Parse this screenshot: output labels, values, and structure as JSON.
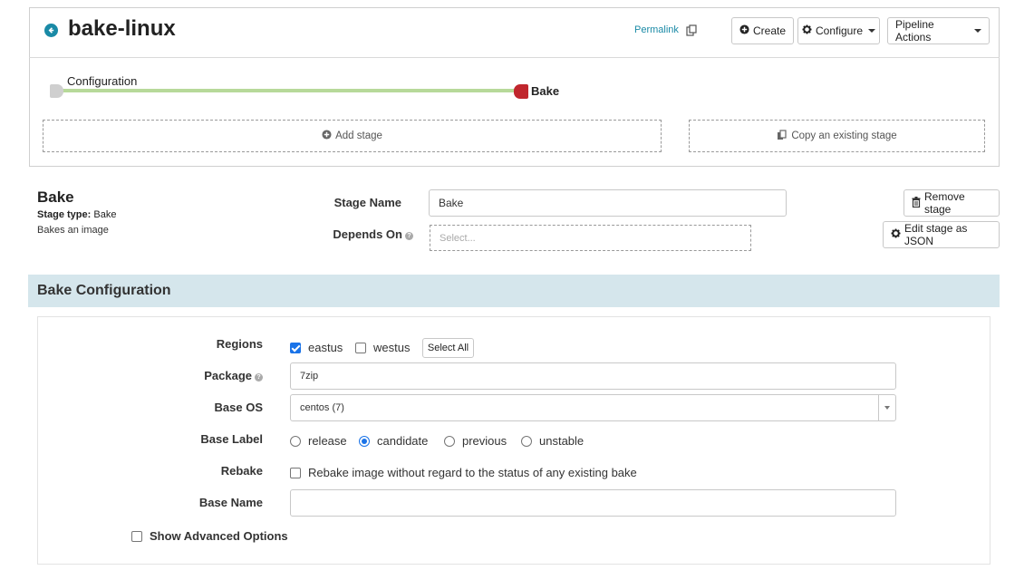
{
  "header": {
    "title": "bake-linux",
    "permalink": "Permalink",
    "create_label": "Create",
    "configure_label": "Configure",
    "pipeline_actions_label": "Pipeline Actions"
  },
  "graph": {
    "nodes": [
      "Configuration",
      "Bake"
    ],
    "add_stage": "Add stage",
    "copy_stage": "Copy an existing stage"
  },
  "stage": {
    "title": "Bake",
    "type_label": "Stage type:",
    "type_value": "Bake",
    "description": "Bakes an image",
    "name_label": "Stage Name",
    "name_value": "Bake",
    "depends_on_label": "Depends On",
    "depends_on_placeholder": "Select...",
    "remove_label": "Remove stage",
    "edit_json_label": "Edit stage as JSON"
  },
  "bake_config": {
    "title": "Bake Configuration",
    "regions_label": "Regions",
    "regions": [
      {
        "name": "eastus",
        "checked": true
      },
      {
        "name": "westus",
        "checked": false
      }
    ],
    "select_all": "Select All",
    "package_label": "Package",
    "package_value": "7zip",
    "base_os_label": "Base OS",
    "base_os_value": "centos (7)",
    "base_label_label": "Base Label",
    "base_label_options": [
      "release",
      "candidate",
      "previous",
      "unstable"
    ],
    "base_label_selected": "candidate",
    "rebake_label": "Rebake",
    "rebake_text": "Rebake image without regard to the status of any existing bake",
    "base_name_label": "Base Name",
    "base_name_value": "",
    "show_advanced": "Show Advanced Options"
  },
  "colors": {
    "accent": "#1a8aa6",
    "bake_node": "#c0262d",
    "graph_line": "#b7d99a",
    "section_bar": "#d5e6ec",
    "checkbox": "#1a73e8"
  }
}
